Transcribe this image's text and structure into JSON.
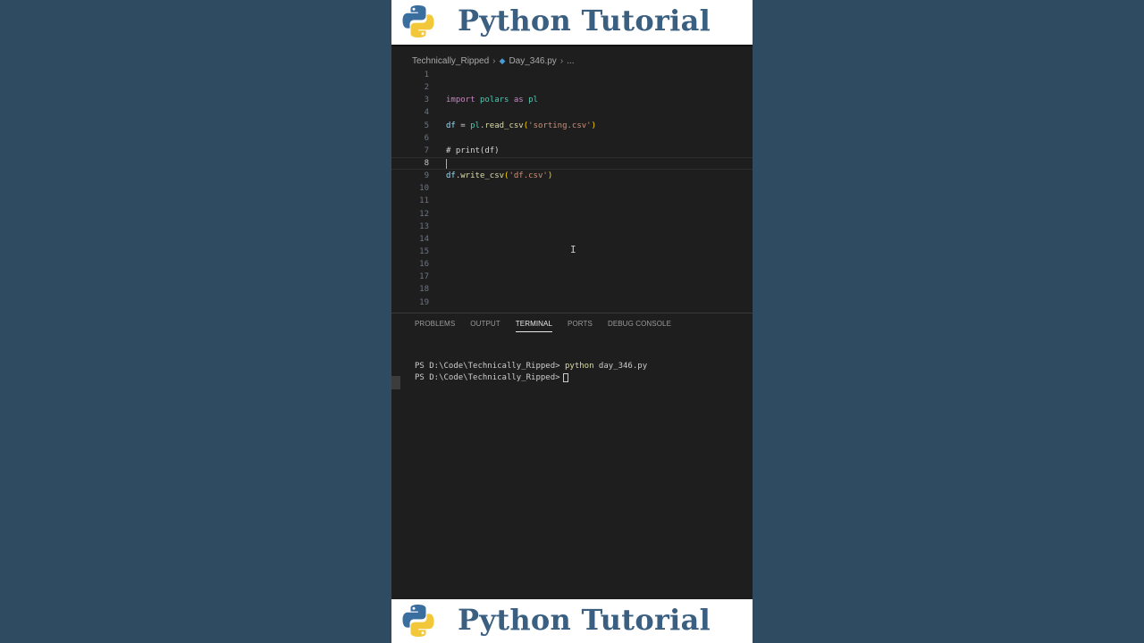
{
  "banner": {
    "title": "Python Tutorial",
    "logo_icon": "python-logo",
    "colors": {
      "blue": "#3a6e9f",
      "yellow": "#f2c83a",
      "title": "#3a5f80"
    }
  },
  "breadcrumb": {
    "folder": "Technically_Ripped",
    "file": "Day_346.py",
    "more": "..."
  },
  "editor": {
    "line_numbers": [
      "1",
      "2",
      "3",
      "4",
      "5",
      "6",
      "7",
      "8",
      "9",
      "10",
      "11",
      "12",
      "13",
      "14",
      "15",
      "16",
      "17",
      "18",
      "19"
    ],
    "current_line": "8"
  },
  "code": {
    "l3_import": "import",
    "l3_polars": "polars",
    "l3_as": "as",
    "l3_pl": "pl",
    "l5_df": "df",
    "l5_eq": " = ",
    "l5_pl": "pl",
    "l5_dot": ".",
    "l5_fn": "read_csv",
    "l5_open": "(",
    "l5_str": "'sorting.csv'",
    "l5_close": ")",
    "l7_comment": "# print(df)",
    "l9_df": "df",
    "l9_dot": ".",
    "l9_fn": "write_csv",
    "l9_open": "(",
    "l9_str": "'df.csv'",
    "l9_close": ")"
  },
  "panel": {
    "tabs": [
      "PROBLEMS",
      "OUTPUT",
      "TERMINAL",
      "PORTS",
      "DEBUG CONSOLE"
    ],
    "active_tab": "TERMINAL"
  },
  "terminal": {
    "prompt": "PS D:\\Code\\Technically_Ripped>",
    "cmd_name": "python",
    "cmd_arg": "day_346.py"
  }
}
